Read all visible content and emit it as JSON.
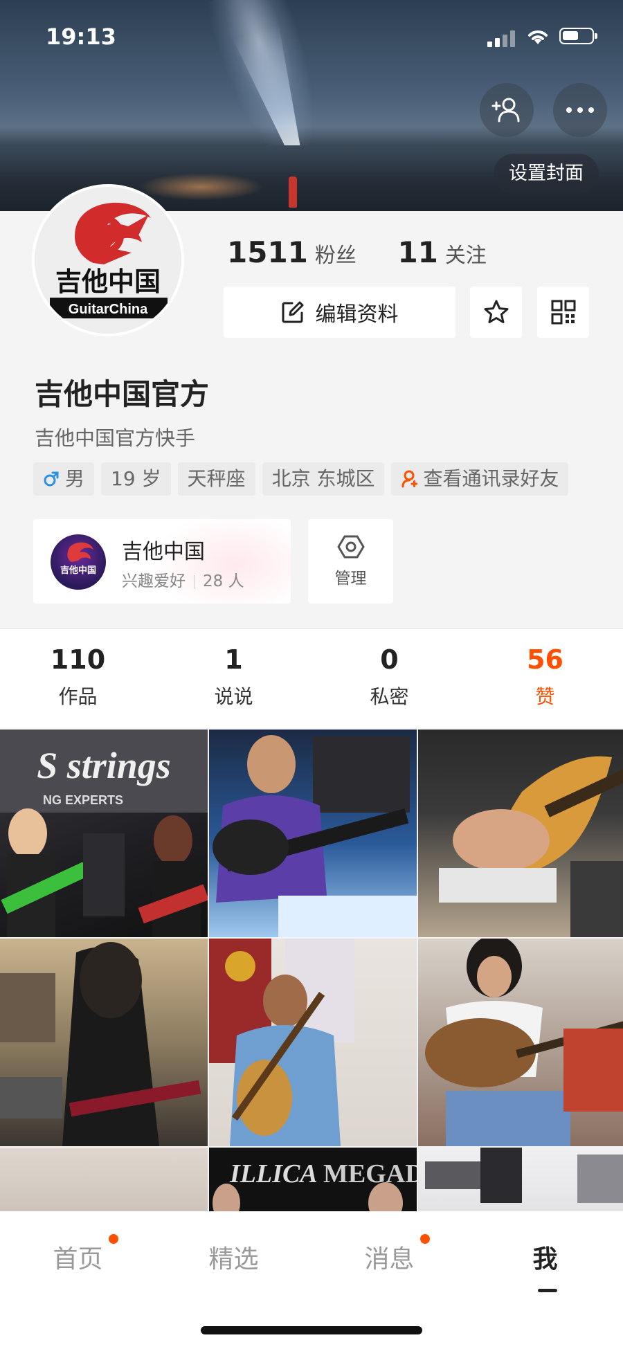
{
  "status": {
    "time": "19:13"
  },
  "cover": {
    "set_cover_label": "设置封面"
  },
  "profile": {
    "fans_count": "1511",
    "fans_label": "粉丝",
    "follow_count": "11",
    "follow_label": "关注",
    "edit_label": "编辑资料",
    "name": "吉他中国官方",
    "bio": "吉他中国官方快手",
    "avatar_text": "吉他中国",
    "avatar_subtext": "GuitarChina",
    "tags": {
      "gender": "男",
      "age": "19 岁",
      "zodiac": "天秤座",
      "location": "北京 东城区",
      "contacts": "查看通讯录好友"
    }
  },
  "group": {
    "name": "吉他中国",
    "category": "兴趣爱好",
    "members": "28 人",
    "logo_text": "吉他中国",
    "manage_label": "管理"
  },
  "content_tabs": [
    {
      "count": "110",
      "label": "作品"
    },
    {
      "count": "1",
      "label": "说说"
    },
    {
      "count": "0",
      "label": "私密"
    },
    {
      "count": "56",
      "label": "赞"
    }
  ],
  "thumbnails": {
    "t1_text": "S strings",
    "t1_sub": "NG EXPERTS",
    "t7_text": "ILLICA",
    "t8_text": "MEGAD"
  },
  "bottom_nav": [
    {
      "label": "首页"
    },
    {
      "label": "精选"
    },
    {
      "label": "消息"
    },
    {
      "label": "我"
    }
  ],
  "colors": {
    "accent": "#ff5000",
    "gender_blue": "#2f8fe0"
  }
}
